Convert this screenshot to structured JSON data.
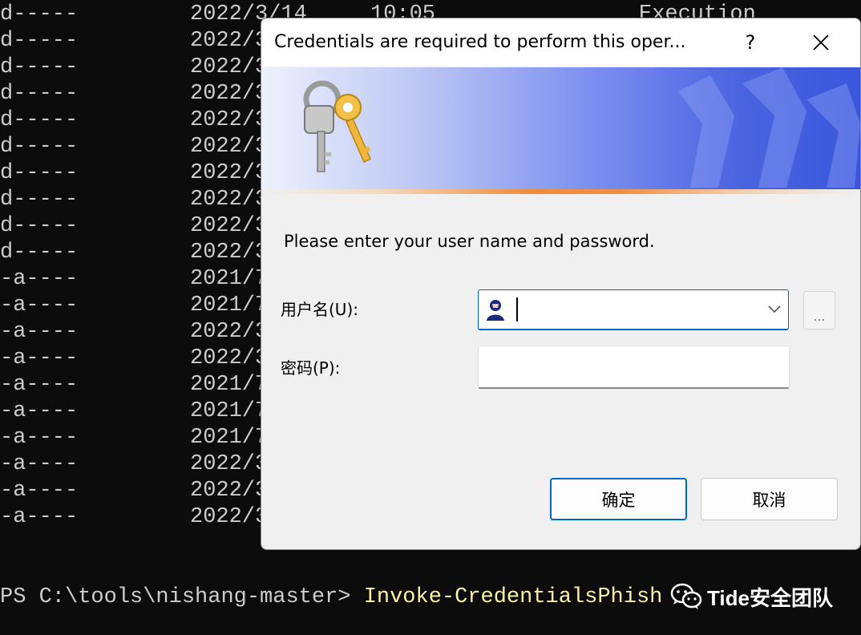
{
  "terminal": {
    "rows": [
      {
        "mode": "d-----",
        "date": "2022/3/14",
        "time": "10:05",
        "name": "Execution"
      },
      {
        "mode": "d-----",
        "date": "2022/3",
        "time": "",
        "name": ""
      },
      {
        "mode": "d-----",
        "date": "2022/3",
        "time": "",
        "name": ""
      },
      {
        "mode": "d-----",
        "date": "2022/3",
        "time": "",
        "name": ""
      },
      {
        "mode": "d-----",
        "date": "2022/3",
        "time": "",
        "name": ""
      },
      {
        "mode": "d-----",
        "date": "2022/3",
        "time": "",
        "name": ""
      },
      {
        "mode": "d-----",
        "date": "2022/3",
        "time": "",
        "name": ""
      },
      {
        "mode": "d-----",
        "date": "2022/3",
        "time": "",
        "name": ""
      },
      {
        "mode": "d-----",
        "date": "2022/3",
        "time": "",
        "name": ""
      },
      {
        "mode": "d-----",
        "date": "2022/3",
        "time": "",
        "name": ""
      },
      {
        "mode": "-a----",
        "date": "2021/7",
        "time": "",
        "name": ""
      },
      {
        "mode": "-a----",
        "date": "2021/7",
        "time": "",
        "name": ""
      },
      {
        "mode": "-a----",
        "date": "2022/3",
        "time": "",
        "name": ""
      },
      {
        "mode": "-a----",
        "date": "2022/3",
        "time": "",
        "name": ""
      },
      {
        "mode": "-a----",
        "date": "2021/7",
        "time": "",
        "name": ""
      },
      {
        "mode": "-a----",
        "date": "2021/7",
        "time": "",
        "name": ""
      },
      {
        "mode": "-a----",
        "date": "2021/7",
        "time": "",
        "name": ""
      },
      {
        "mode": "-a----",
        "date": "2022/3",
        "time": "",
        "name": ""
      },
      {
        "mode": "-a----",
        "date": "2022/3",
        "time": "",
        "name": ""
      },
      {
        "mode": "-a----",
        "date": "2022/3",
        "time": "",
        "name": ""
      }
    ],
    "prompt": "PS C:\\tools\\nishang-master> ",
    "command": "Invoke-CredentialsPhish"
  },
  "watermark": {
    "text": "Tide安全团队",
    "icon": "wechat-icon"
  },
  "dialog": {
    "title": "Credentials are required to perform this oper...",
    "help_label": "?",
    "banner_icon": "keys-icon",
    "message": "Please enter your user name and password.",
    "username_label": "用户名(U):",
    "username_value": "",
    "username_icon": "user-icon",
    "browse_label": "...",
    "password_label": "密码(P):",
    "password_value": "",
    "ok_label": "确定",
    "cancel_label": "取消"
  },
  "colors": {
    "terminal_bg": "#0c0c0c",
    "terminal_text": "#cccccc",
    "command_text": "#f9f1a5",
    "accent": "#0067c0",
    "banner_blue": "#3a57dc",
    "banner_orange": "#ef8c3a"
  }
}
